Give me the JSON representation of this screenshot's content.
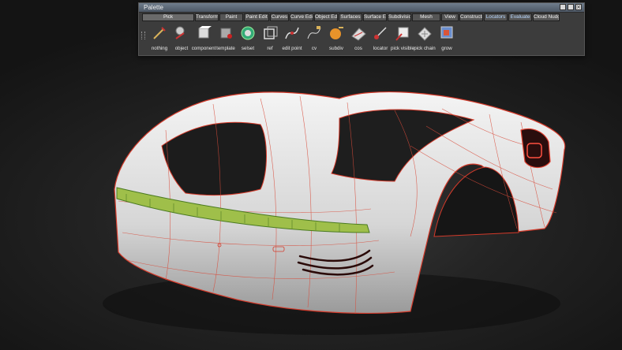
{
  "palette": {
    "title": "Palette",
    "window_buttons": [
      "",
      "",
      "×"
    ],
    "tabs": [
      {
        "label": "Pick",
        "w": 66,
        "active": true,
        "hl": false
      },
      {
        "label": "Transform",
        "w": 30,
        "active": false,
        "hl": false
      },
      {
        "label": "Paint",
        "w": 30,
        "active": false,
        "hl": false
      },
      {
        "label": "Paint Edit",
        "w": 32,
        "active": false,
        "hl": false
      },
      {
        "label": "Curves",
        "w": 24,
        "active": false,
        "hl": false
      },
      {
        "label": "Curve Edit",
        "w": 30,
        "active": false,
        "hl": false
      },
      {
        "label": "Object Edit",
        "w": 30,
        "active": false,
        "hl": false
      },
      {
        "label": "Surfaces",
        "w": 30,
        "active": false,
        "hl": false
      },
      {
        "label": "Surface Edit",
        "w": 30,
        "active": false,
        "hl": false
      },
      {
        "label": "Subdivision",
        "w": 30,
        "active": false,
        "hl": false
      },
      {
        "label": "Mesh",
        "w": 36,
        "active": false,
        "hl": false
      },
      {
        "label": "View",
        "w": 22,
        "active": false,
        "hl": false
      },
      {
        "label": "Construction",
        "w": 30,
        "active": false,
        "hl": false
      },
      {
        "label": "Locators",
        "w": 30,
        "active": false,
        "hl": true
      },
      {
        "label": "Evaluate",
        "w": 30,
        "active": false,
        "hl": true
      },
      {
        "label": "Cloud Nudge",
        "w": 34,
        "active": false,
        "hl": false
      }
    ],
    "tools": [
      {
        "name": "nothing",
        "label": "nothing",
        "icon": "nothing-icon"
      },
      {
        "name": "object",
        "label": "object",
        "icon": "object-icon"
      },
      {
        "name": "component",
        "label": "component",
        "icon": "component-icon"
      },
      {
        "name": "template",
        "label": "template",
        "icon": "template-icon"
      },
      {
        "name": "selset",
        "label": "selset",
        "icon": "selset-icon"
      },
      {
        "name": "ref",
        "label": "ref",
        "icon": "ref-icon"
      },
      {
        "name": "edit-point",
        "label": "edit point",
        "icon": "edit-point-icon"
      },
      {
        "name": "cv",
        "label": "cv",
        "icon": "cv-icon"
      },
      {
        "name": "subdiv",
        "label": "subdiv",
        "icon": "subdiv-icon"
      },
      {
        "name": "cos",
        "label": "cos",
        "icon": "cos-icon"
      },
      {
        "name": "locator",
        "label": "locator",
        "icon": "locator-icon"
      },
      {
        "name": "pick-visible",
        "label": "pick visible",
        "icon": "pick-visible-icon"
      },
      {
        "name": "pick-chain",
        "label": "pick chain",
        "icon": "pick-chain-icon"
      },
      {
        "name": "grow",
        "label": "grow",
        "icon": "grow-icon"
      }
    ]
  },
  "viewport": {
    "name": "3d-viewport",
    "model": "car-surface-model"
  }
}
